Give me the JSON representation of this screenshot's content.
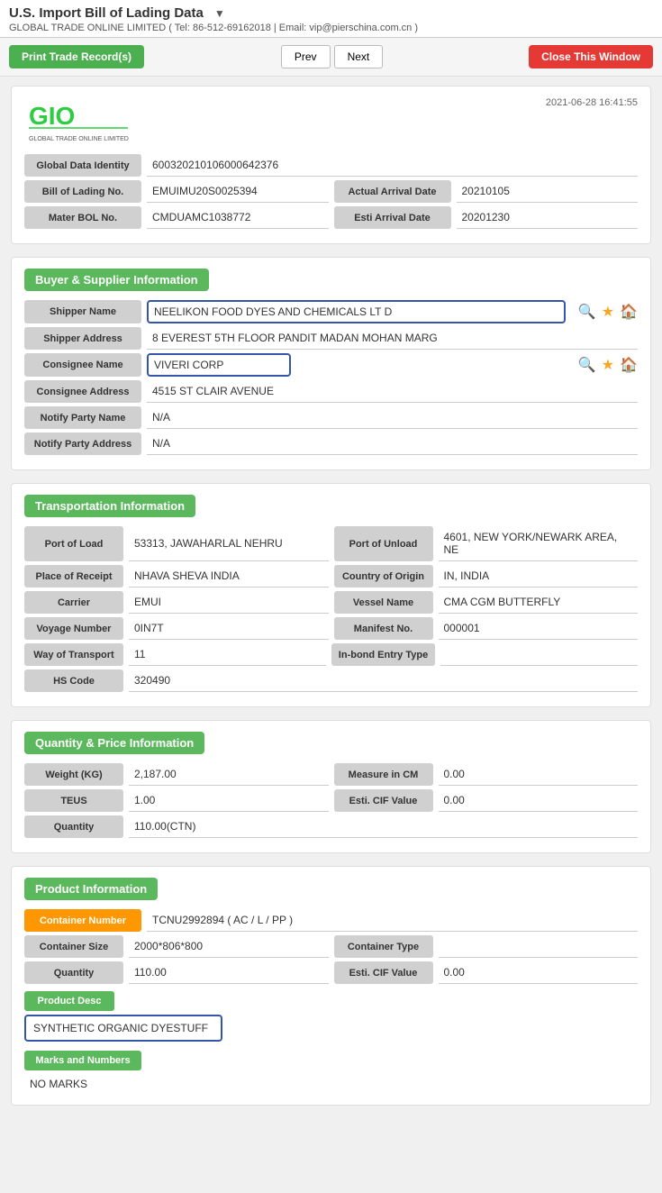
{
  "header": {
    "title": "U.S. Import Bill of Lading Data",
    "subtitle": "GLOBAL TRADE ONLINE LIMITED ( Tel: 86-512-69162018 | Email: vip@pierschina.com.cn )",
    "datetime": "2021-06-28 16:41:55"
  },
  "toolbar": {
    "print_label": "Print Trade Record(s)",
    "prev_label": "Prev",
    "next_label": "Next",
    "close_label": "Close This Window"
  },
  "identity": {
    "global_data_identity_label": "Global Data Identity",
    "global_data_identity_value": "600320210106000642376",
    "bol_no_label": "Bill of Lading No.",
    "bol_no_value": "EMUIMU20S0025394",
    "actual_arrival_date_label": "Actual Arrival Date",
    "actual_arrival_date_value": "20210105",
    "mater_bol_label": "Mater BOL No.",
    "mater_bol_value": "CMDUAMC1038772",
    "esti_arrival_date_label": "Esti Arrival Date",
    "esti_arrival_date_value": "20201230"
  },
  "buyer_supplier": {
    "section_title": "Buyer & Supplier Information",
    "shipper_name_label": "Shipper Name",
    "shipper_name_value": "NEELIKON FOOD DYES AND CHEMICALS LT D",
    "shipper_address_label": "Shipper Address",
    "shipper_address_value": "8 EVEREST 5TH FLOOR PANDIT MADAN MOHAN MARG",
    "consignee_name_label": "Consignee Name",
    "consignee_name_value": "VIVERI CORP",
    "consignee_address_label": "Consignee Address",
    "consignee_address_value": "4515 ST CLAIR AVENUE",
    "notify_party_name_label": "Notify Party Name",
    "notify_party_name_value": "N/A",
    "notify_party_address_label": "Notify Party Address",
    "notify_party_address_value": "N/A"
  },
  "transportation": {
    "section_title": "Transportation Information",
    "port_of_load_label": "Port of Load",
    "port_of_load_value": "53313, JAWAHARLAL NEHRU",
    "port_of_unload_label": "Port of Unload",
    "port_of_unload_value": "4601, NEW YORK/NEWARK AREA, NE",
    "place_of_receipt_label": "Place of Receipt",
    "place_of_receipt_value": "NHAVA SHEVA INDIA",
    "country_of_origin_label": "Country of Origin",
    "country_of_origin_value": "IN, INDIA",
    "carrier_label": "Carrier",
    "carrier_value": "EMUI",
    "vessel_name_label": "Vessel Name",
    "vessel_name_value": "CMA CGM BUTTERFLY",
    "voyage_number_label": "Voyage Number",
    "voyage_number_value": "0IN7T",
    "manifest_no_label": "Manifest No.",
    "manifest_no_value": "000001",
    "way_of_transport_label": "Way of Transport",
    "way_of_transport_value": "11",
    "in_bond_entry_type_label": "In-bond Entry Type",
    "in_bond_entry_type_value": "",
    "hs_code_label": "HS Code",
    "hs_code_value": "320490"
  },
  "quantity_price": {
    "section_title": "Quantity & Price Information",
    "weight_kg_label": "Weight (KG)",
    "weight_kg_value": "2,187.00",
    "measure_in_cm_label": "Measure in CM",
    "measure_in_cm_value": "0.00",
    "teus_label": "TEUS",
    "teus_value": "1.00",
    "esti_cif_value_label": "Esti. CIF Value",
    "esti_cif_value_value": "0.00",
    "quantity_label": "Quantity",
    "quantity_value": "110.00(CTN)"
  },
  "product": {
    "section_title": "Product Information",
    "container_number_label": "Container Number",
    "container_number_value": "TCNU2992894 ( AC / L / PP )",
    "container_size_label": "Container Size",
    "container_size_value": "2000*806*800",
    "container_type_label": "Container Type",
    "container_type_value": "",
    "quantity_label": "Quantity",
    "quantity_value": "110.00",
    "esti_cif_value_label": "Esti. CIF Value",
    "esti_cif_value_value": "0.00",
    "product_desc_label": "Product Desc",
    "product_desc_value": "SYNTHETIC ORGANIC DYESTUFF",
    "marks_and_numbers_label": "Marks and Numbers",
    "marks_and_numbers_value": "NO MARKS"
  }
}
